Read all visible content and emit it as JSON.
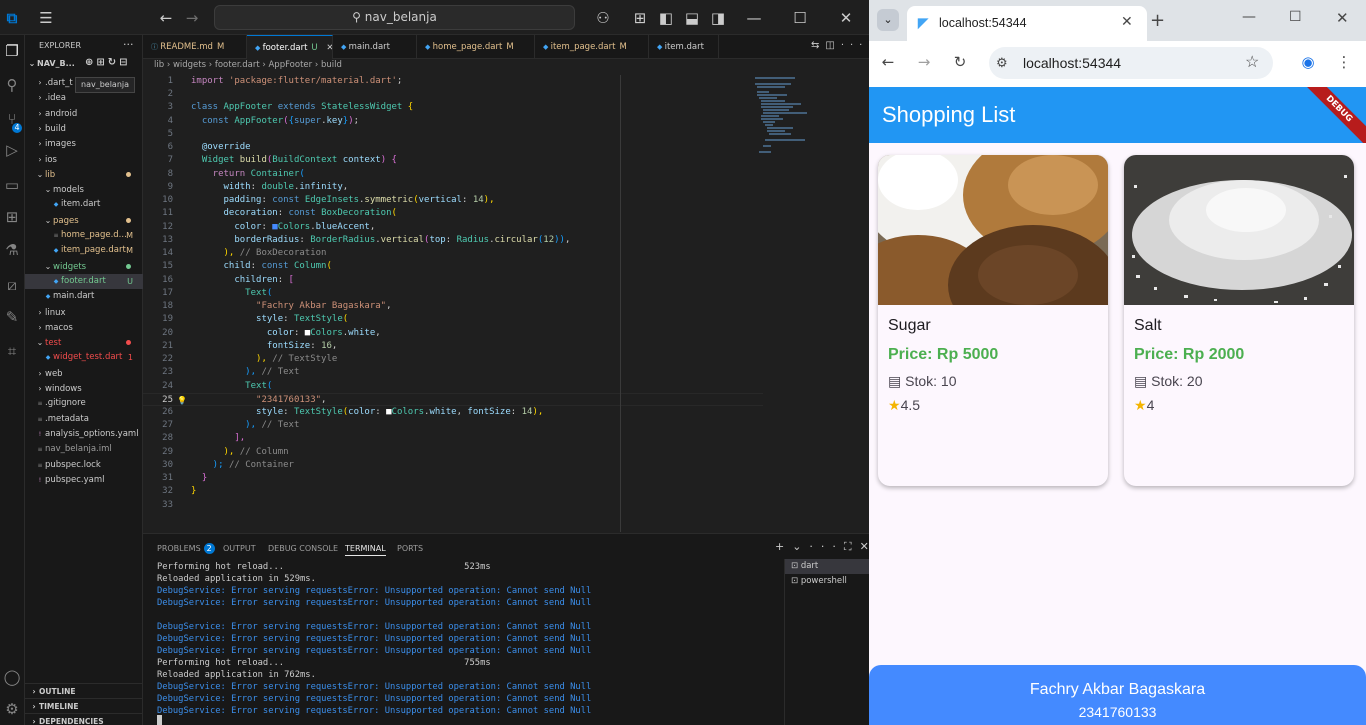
{
  "vscode": {
    "title_search": "nav_belanja",
    "explorer": {
      "header": "EXPLORER",
      "project": "NAV_B...",
      "tooltip": "nav_belanja",
      "items": [
        {
          "label": ".dart_t",
          "level": 0,
          "kind": "folder",
          "color": "#cccccc"
        },
        {
          "label": ".idea",
          "level": 0,
          "kind": "folder",
          "color": "#cccccc"
        },
        {
          "label": "android",
          "level": 0,
          "kind": "folder",
          "color": "#cccccc"
        },
        {
          "label": "build",
          "level": 0,
          "kind": "folder",
          "color": "#cccccc"
        },
        {
          "label": "images",
          "level": 0,
          "kind": "folder",
          "color": "#cccccc"
        },
        {
          "label": "ios",
          "level": 0,
          "kind": "folder",
          "color": "#cccccc"
        },
        {
          "label": "lib",
          "level": 0,
          "kind": "open",
          "color": "#e2c08d",
          "dot": "#e2c08d"
        },
        {
          "label": "models",
          "level": 1,
          "kind": "open",
          "color": "#cccccc"
        },
        {
          "label": "item.dart",
          "level": 2,
          "kind": "file",
          "color": "#cccccc"
        },
        {
          "label": "pages",
          "level": 1,
          "kind": "open",
          "color": "#e2c08d",
          "dot": "#e2c08d"
        },
        {
          "label": "home_page.d...",
          "level": 2,
          "kind": "file",
          "color": "#e2c08d",
          "indicator": "M"
        },
        {
          "label": "item_page.dart",
          "level": 2,
          "kind": "file",
          "color": "#e2c08d",
          "indicator": "M"
        },
        {
          "label": "widgets",
          "level": 1,
          "kind": "open",
          "color": "#73c991",
          "dot": "#73c991"
        },
        {
          "label": "footer.dart",
          "level": 2,
          "kind": "file",
          "color": "#73c991",
          "indicator": "U",
          "selected": true
        },
        {
          "label": "main.dart",
          "level": 1,
          "kind": "file",
          "color": "#cccccc"
        },
        {
          "label": "linux",
          "level": 0,
          "kind": "folder",
          "color": "#cccccc"
        },
        {
          "label": "macos",
          "level": 0,
          "kind": "folder",
          "color": "#cccccc"
        },
        {
          "label": "test",
          "level": 0,
          "kind": "open",
          "color": "#f14c4c",
          "dot": "#f14c4c"
        },
        {
          "label": "widget_test.dart",
          "level": 1,
          "kind": "file",
          "color": "#f14c4c",
          "indicator": "1"
        },
        {
          "label": "web",
          "level": 0,
          "kind": "folder",
          "color": "#cccccc"
        },
        {
          "label": "windows",
          "level": 0,
          "kind": "folder",
          "color": "#cccccc"
        },
        {
          "label": ".gitignore",
          "level": 0,
          "kind": "file",
          "color": "#cccccc"
        },
        {
          "label": ".metadata",
          "level": 0,
          "kind": "file",
          "color": "#cccccc"
        },
        {
          "label": "analysis_options.yaml",
          "level": 0,
          "kind": "file",
          "color": "#cccccc"
        },
        {
          "label": "nav_belanja.iml",
          "level": 0,
          "kind": "file",
          "color": "#9d9d9d"
        },
        {
          "label": "pubspec.lock",
          "level": 0,
          "kind": "file",
          "color": "#cccccc"
        },
        {
          "label": "pubspec.yaml",
          "level": 0,
          "kind": "file",
          "color": "#cccccc"
        }
      ],
      "sections": [
        "OUTLINE",
        "TIMELINE",
        "DEPENDENCIES"
      ]
    },
    "tabs": [
      {
        "label": "README.md",
        "indicator": "M",
        "color": "#e2c08d"
      },
      {
        "label": "footer.dart",
        "indicator": "U",
        "color": "#73c991",
        "active": true
      },
      {
        "label": "main.dart",
        "indicator": "",
        "color": "#cccccc"
      },
      {
        "label": "home_page.dart",
        "indicator": "M",
        "color": "#e2c08d"
      },
      {
        "label": "item_page.dart",
        "indicator": "M",
        "color": "#e2c08d"
      },
      {
        "label": "item.dart",
        "indicator": "",
        "color": "#cccccc"
      }
    ],
    "breadcrumb": [
      "lib",
      "widgets",
      "footer.dart",
      "AppFooter",
      "build"
    ],
    "current_line": 25,
    "code": [
      {
        "n": 1,
        "t": [
          [
            "import ",
            "#c586c0"
          ],
          [
            "'package:flutter/material.dart'",
            "#ce9178"
          ],
          [
            ";",
            "#cccccc"
          ]
        ]
      },
      {
        "n": 2,
        "t": []
      },
      {
        "n": 3,
        "t": [
          [
            "class ",
            "#569cd6"
          ],
          [
            "AppFooter ",
            "#4ec9b0"
          ],
          [
            "extends ",
            "#569cd6"
          ],
          [
            "StatelessWidget ",
            "#4ec9b0"
          ],
          [
            "{",
            "#ffd700"
          ]
        ]
      },
      {
        "n": 4,
        "t": [
          [
            "  const ",
            "#569cd6"
          ],
          [
            "AppFooter",
            "#4ec9b0"
          ],
          [
            "(",
            "#da70d6"
          ],
          [
            "{",
            "#179fff"
          ],
          [
            "super",
            "#569cd6"
          ],
          [
            ".",
            "#cccccc"
          ],
          [
            "key",
            "#9cdcfe"
          ],
          [
            "}",
            "#179fff"
          ],
          [
            ")",
            "#da70d6"
          ],
          [
            ";",
            "#cccccc"
          ]
        ]
      },
      {
        "n": 5,
        "t": []
      },
      {
        "n": 6,
        "t": [
          [
            "  @override",
            "#9cdcfe"
          ]
        ]
      },
      {
        "n": 7,
        "t": [
          [
            "  Widget ",
            "#4ec9b0"
          ],
          [
            "build",
            "#dcdcaa"
          ],
          [
            "(",
            "#da70d6"
          ],
          [
            "BuildContext ",
            "#4ec9b0"
          ],
          [
            "context",
            "#9cdcfe"
          ],
          [
            ") ",
            "#da70d6"
          ],
          [
            "{",
            "#da70d6"
          ]
        ]
      },
      {
        "n": 8,
        "t": [
          [
            "    return ",
            "#c586c0"
          ],
          [
            "Container",
            "#4ec9b0"
          ],
          [
            "(",
            "#179fff"
          ]
        ]
      },
      {
        "n": 9,
        "t": [
          [
            "      width",
            "#9cdcfe"
          ],
          [
            ": ",
            "#cccccc"
          ],
          [
            "double",
            "#4ec9b0"
          ],
          [
            ".",
            "#cccccc"
          ],
          [
            "infinity",
            "#9cdcfe"
          ],
          [
            ",",
            "#cccccc"
          ]
        ]
      },
      {
        "n": 10,
        "t": [
          [
            "      padding",
            "#9cdcfe"
          ],
          [
            ": ",
            "#cccccc"
          ],
          [
            "const ",
            "#569cd6"
          ],
          [
            "EdgeInsets",
            "#4ec9b0"
          ],
          [
            ".",
            "#cccccc"
          ],
          [
            "symmetric",
            "#dcdcaa"
          ],
          [
            "(",
            "#ffd700"
          ],
          [
            "vertical",
            "#9cdcfe"
          ],
          [
            ": ",
            "#cccccc"
          ],
          [
            "14",
            "#b5cea8"
          ],
          [
            "),",
            "#ffd700"
          ]
        ]
      },
      {
        "n": 11,
        "t": [
          [
            "      decoration",
            "#9cdcfe"
          ],
          [
            ": ",
            "#cccccc"
          ],
          [
            "const ",
            "#569cd6"
          ],
          [
            "BoxDecoration",
            "#4ec9b0"
          ],
          [
            "(",
            "#ffd700"
          ]
        ]
      },
      {
        "n": 12,
        "t": [
          [
            "        color",
            "#9cdcfe"
          ],
          [
            ": ",
            "#cccccc"
          ],
          [
            "■",
            "#448aff"
          ],
          [
            "Colors",
            "#4ec9b0"
          ],
          [
            ".",
            "#cccccc"
          ],
          [
            "blueAccent",
            "#9cdcfe"
          ],
          [
            ",",
            "#cccccc"
          ]
        ]
      },
      {
        "n": 13,
        "t": [
          [
            "        borderRadius",
            "#9cdcfe"
          ],
          [
            ": ",
            "#cccccc"
          ],
          [
            "BorderRadius",
            "#4ec9b0"
          ],
          [
            ".",
            "#cccccc"
          ],
          [
            "vertical",
            "#dcdcaa"
          ],
          [
            "(",
            "#da70d6"
          ],
          [
            "top",
            "#9cdcfe"
          ],
          [
            ": ",
            "#cccccc"
          ],
          [
            "Radius",
            "#4ec9b0"
          ],
          [
            ".",
            "#cccccc"
          ],
          [
            "circular",
            "#dcdcaa"
          ],
          [
            "(",
            "#179fff"
          ],
          [
            "12",
            "#b5cea8"
          ],
          [
            "))",
            "#179fff"
          ],
          [
            ",",
            "#cccccc"
          ]
        ]
      },
      {
        "n": 14,
        "t": [
          [
            "      ), ",
            "#ffd700"
          ],
          [
            "// BoxDecoration",
            "#8b8b8b"
          ]
        ]
      },
      {
        "n": 15,
        "t": [
          [
            "      child",
            "#9cdcfe"
          ],
          [
            ": ",
            "#cccccc"
          ],
          [
            "const ",
            "#569cd6"
          ],
          [
            "Column",
            "#4ec9b0"
          ],
          [
            "(",
            "#ffd700"
          ]
        ]
      },
      {
        "n": 16,
        "t": [
          [
            "        children",
            "#9cdcfe"
          ],
          [
            ": ",
            "#cccccc"
          ],
          [
            "[",
            "#da70d6"
          ]
        ]
      },
      {
        "n": 17,
        "t": [
          [
            "          Text",
            "#4ec9b0"
          ],
          [
            "(",
            "#179fff"
          ]
        ]
      },
      {
        "n": 18,
        "t": [
          [
            "            \"Fachry Akbar Bagaskara\"",
            "#ce9178"
          ],
          [
            ",",
            "#cccccc"
          ]
        ]
      },
      {
        "n": 19,
        "t": [
          [
            "            style",
            "#9cdcfe"
          ],
          [
            ": ",
            "#cccccc"
          ],
          [
            "TextStyle",
            "#4ec9b0"
          ],
          [
            "(",
            "#ffd700"
          ]
        ]
      },
      {
        "n": 20,
        "t": [
          [
            "              color",
            "#9cdcfe"
          ],
          [
            ": ",
            "#cccccc"
          ],
          [
            "■",
            "#ffffff"
          ],
          [
            "Colors",
            "#4ec9b0"
          ],
          [
            ".",
            "#cccccc"
          ],
          [
            "white",
            "#9cdcfe"
          ],
          [
            ",",
            "#cccccc"
          ]
        ]
      },
      {
        "n": 21,
        "t": [
          [
            "              fontSize",
            "#9cdcfe"
          ],
          [
            ": ",
            "#cccccc"
          ],
          [
            "16",
            "#b5cea8"
          ],
          [
            ",",
            "#cccccc"
          ]
        ]
      },
      {
        "n": 22,
        "t": [
          [
            "            ), ",
            "#ffd700"
          ],
          [
            "// TextStyle",
            "#8b8b8b"
          ]
        ]
      },
      {
        "n": 23,
        "t": [
          [
            "          ), ",
            "#179fff"
          ],
          [
            "// Text",
            "#8b8b8b"
          ]
        ]
      },
      {
        "n": 24,
        "t": [
          [
            "          Text",
            "#4ec9b0"
          ],
          [
            "(",
            "#179fff"
          ]
        ]
      },
      {
        "n": 25,
        "t": [
          [
            "            \"2341760133\"",
            "#ce9178"
          ],
          [
            ",",
            "#cccccc"
          ]
        ]
      },
      {
        "n": 26,
        "t": [
          [
            "            style",
            "#9cdcfe"
          ],
          [
            ": ",
            "#cccccc"
          ],
          [
            "TextStyle",
            "#4ec9b0"
          ],
          [
            "(",
            "#ffd700"
          ],
          [
            "color",
            "#9cdcfe"
          ],
          [
            ": ",
            "#cccccc"
          ],
          [
            "■",
            "#ffffff"
          ],
          [
            "Colors",
            "#4ec9b0"
          ],
          [
            ".",
            "#cccccc"
          ],
          [
            "white",
            "#9cdcfe"
          ],
          [
            ", ",
            "#cccccc"
          ],
          [
            "fontSize",
            "#9cdcfe"
          ],
          [
            ": ",
            "#cccccc"
          ],
          [
            "14",
            "#b5cea8"
          ],
          [
            "),",
            "#ffd700"
          ]
        ]
      },
      {
        "n": 27,
        "t": [
          [
            "          ), ",
            "#179fff"
          ],
          [
            "// Text",
            "#8b8b8b"
          ]
        ]
      },
      {
        "n": 28,
        "t": [
          [
            "        ],",
            "#da70d6"
          ]
        ]
      },
      {
        "n": 29,
        "t": [
          [
            "      ), ",
            "#ffd700"
          ],
          [
            "// Column",
            "#8b8b8b"
          ]
        ]
      },
      {
        "n": 30,
        "t": [
          [
            "    ); ",
            "#179fff"
          ],
          [
            "// Container",
            "#8b8b8b"
          ]
        ]
      },
      {
        "n": 31,
        "t": [
          [
            "  }",
            "#da70d6"
          ]
        ]
      },
      {
        "n": 32,
        "t": [
          [
            "}",
            "#ffd700"
          ]
        ]
      },
      {
        "n": 33,
        "t": []
      }
    ],
    "panel": {
      "tabs": [
        "PROBLEMS",
        "OUTPUT",
        "DEBUG CONSOLE",
        "TERMINAL",
        "PORTS"
      ],
      "problems_count": "2",
      "active_tab": "TERMINAL",
      "terminal": [
        {
          "text": "Performing hot reload...                                  523ms",
          "color": "#cccccc"
        },
        {
          "text": "Reloaded application in 529ms.",
          "color": "#cccccc"
        },
        {
          "text": "DebugService: Error serving requestsError: Unsupported operation: Cannot send Null",
          "color": "#3b8eea"
        },
        {
          "text": "DebugService: Error serving requestsError: Unsupported operation: Cannot send Null",
          "color": "#3b8eea"
        },
        {
          "text": "",
          "color": "#cccccc"
        },
        {
          "text": "DebugService: Error serving requestsError: Unsupported operation: Cannot send Null",
          "color": "#3b8eea"
        },
        {
          "text": "DebugService: Error serving requestsError: Unsupported operation: Cannot send Null",
          "color": "#3b8eea"
        },
        {
          "text": "DebugService: Error serving requestsError: Unsupported operation: Cannot send Null",
          "color": "#3b8eea"
        },
        {
          "text": "Performing hot reload...                                  755ms",
          "color": "#cccccc"
        },
        {
          "text": "Reloaded application in 762ms.",
          "color": "#cccccc"
        },
        {
          "text": "DebugService: Error serving requestsError: Unsupported operation: Cannot send Null",
          "color": "#3b8eea"
        },
        {
          "text": "DebugService: Error serving requestsError: Unsupported operation: Cannot send Null",
          "color": "#3b8eea"
        },
        {
          "text": "DebugService: Error serving requestsError: Unsupported operation: Cannot send Null",
          "color": "#3b8eea"
        }
      ],
      "terminal_sessions": [
        "dart",
        "powershell"
      ]
    }
  },
  "browser": {
    "tab_title": "localhost:54344",
    "url": "localhost:54344",
    "app": {
      "title": "Shopping List",
      "debug_banner": "DEBUG",
      "items": [
        {
          "name": "Sugar",
          "price": "Price: Rp 5000",
          "stock": "Stok: 10",
          "rating": "4.5"
        },
        {
          "name": "Salt",
          "price": "Price: Rp 2000",
          "stock": "Stok: 20",
          "rating": "4"
        }
      ],
      "footer": {
        "name": "Fachry Akbar Bagaskara",
        "nim": "2341760133"
      }
    }
  }
}
